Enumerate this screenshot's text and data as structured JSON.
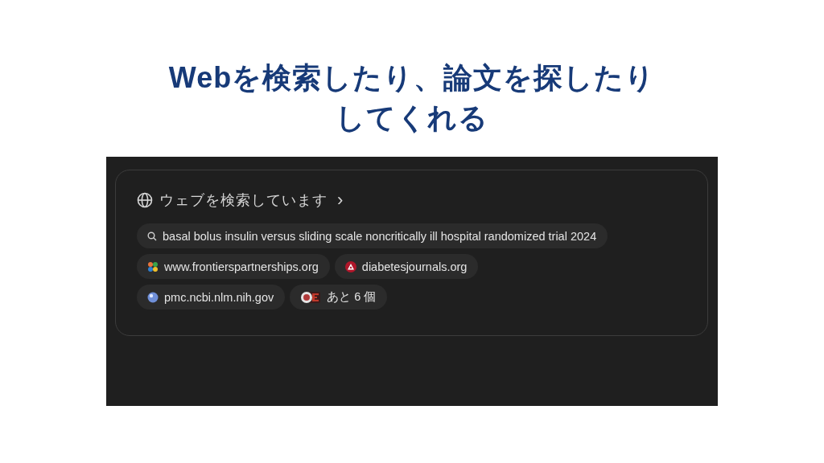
{
  "slide_title": "Webを検索したり、論文を探したりしてくれる",
  "panel": {
    "header": {
      "label": "ウェブを検索しています",
      "chevron": "›"
    },
    "chips": [
      {
        "kind": "query",
        "label": "basal bolus insulin versus sliding scale noncritically ill hospital randomized trial 2024"
      },
      {
        "kind": "site",
        "label": "www.frontierspartnerships.org"
      },
      {
        "kind": "site",
        "label": "diabetesjournals.org"
      },
      {
        "kind": "site",
        "label": "pmc.ncbi.nlm.nih.gov"
      },
      {
        "kind": "more",
        "label": "あと 6 個"
      }
    ]
  }
}
